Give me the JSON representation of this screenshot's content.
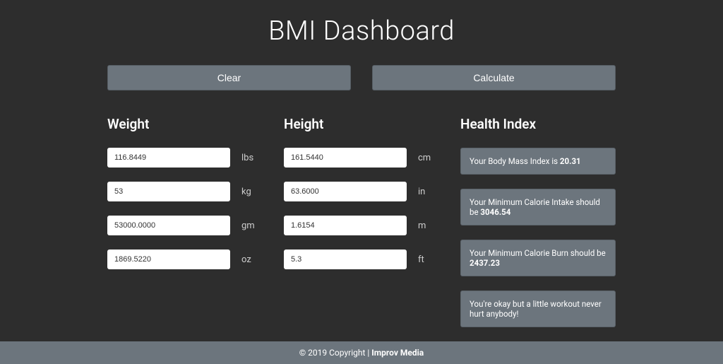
{
  "title": "BMI Dashboard",
  "buttons": {
    "clear": "Clear",
    "calculate": "Calculate"
  },
  "weight": {
    "heading": "Weight",
    "lbs": {
      "value": "116.8449",
      "unit": "lbs"
    },
    "kg": {
      "value": "53",
      "unit": "kg"
    },
    "gm": {
      "value": "53000.0000",
      "unit": "gm"
    },
    "oz": {
      "value": "1869.5220",
      "unit": "oz"
    }
  },
  "height": {
    "heading": "Height",
    "cm": {
      "value": "161.5440",
      "unit": "cm"
    },
    "in": {
      "value": "63.6000",
      "unit": "in"
    },
    "m": {
      "value": "1.6154",
      "unit": "m"
    },
    "ft": {
      "value": "5.3",
      "unit": "ft"
    }
  },
  "health": {
    "heading": "Health Index",
    "bmi": {
      "text": "Your Body Mass Index is ",
      "value": "20.31"
    },
    "calorie_intake": {
      "text": "Your Minimum Calorie Intake should be ",
      "value": "3046.54"
    },
    "calorie_burn": {
      "text": "Your Minimum Calorie Burn should be ",
      "value": "2437.23"
    },
    "message": "You're okay but a little workout never hurt anybody!"
  },
  "footer": {
    "copyright": "© 2019 Copyright | ",
    "brand": "Improv Media"
  }
}
